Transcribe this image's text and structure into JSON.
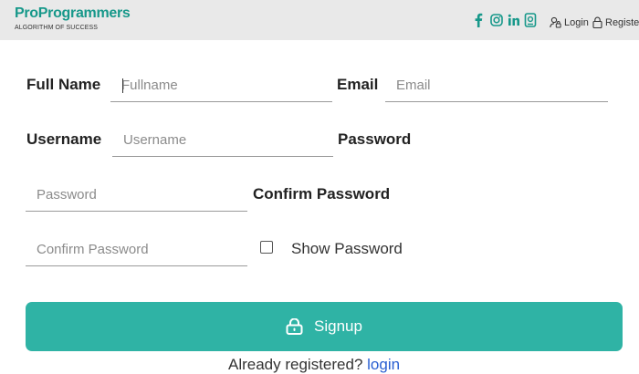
{
  "header": {
    "brand_name": "ProProgrammers",
    "brand_tagline": "ALGORITHM OF SUCCESS",
    "login_label": "Login",
    "register_label": "Register",
    "social_icons": [
      "facebook-icon",
      "instagram-icon",
      "linkedin-icon",
      "badge-icon"
    ],
    "accent_color": "#17988a"
  },
  "form": {
    "fullname_label": "Full Name",
    "fullname_placeholder": "Fullname",
    "email_label": "Email",
    "email_placeholder": "Email",
    "username_label": "Username",
    "username_placeholder": "Username",
    "password_label": "Password",
    "password_placeholder": "Password",
    "confirm_password_label": "Confirm Password",
    "confirm_password_placeholder": "Confirm Password",
    "show_password_label": "Show Password",
    "show_password_checked": false,
    "signup_label": "Signup",
    "button_color": "#2fb3a5"
  },
  "footer": {
    "already_text": "Already registered?",
    "login_link": "login"
  }
}
